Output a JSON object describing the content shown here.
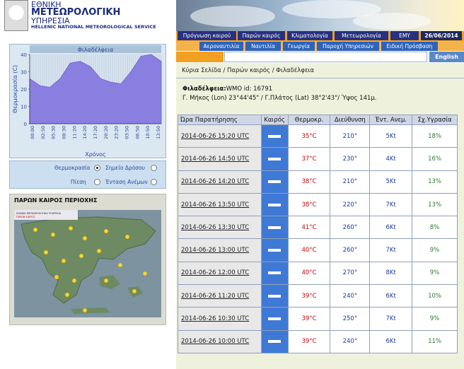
{
  "header": {
    "org_line1": "ΕΘΝΙΚΗ",
    "org_line2": "ΜΕΤΕΩΡΟΛΟΓΙΚΗ",
    "org_line3": "ΥΠΗΡΕΣΙΑ",
    "org_english": "HELLENIC NATIONAL METEOROLOGICAL SERVICE"
  },
  "nav": {
    "items": [
      "Πρόγνωση καιρού",
      "Παρών καιρός",
      "Κλιματολογία",
      "Μετεωρολογία",
      "ΕΜΥ"
    ],
    "date": "26/06/2014",
    "subitems": [
      "Αεροναυτιλία",
      "Ναυτιλία",
      "Γεωργία",
      "Παροχή Υπηρεσιών",
      "Ειδική Πρόσβαση"
    ],
    "english": "English"
  },
  "breadcrumb": "Κύρια Σελίδα / Παρών καιρός / Φιλαδέλφεια",
  "station": {
    "name": "Φιλαδέλφεια:",
    "wmo": "WMO id: 16791",
    "coords": "Γ. Μήκος (Lon) 23°44'45\" / Γ.Πλάτος (Lat) 38°2'43\"/ Ύψος 141μ."
  },
  "chart_data": {
    "type": "area",
    "title": "Φιλαδέλφεια",
    "ylabel": "Θερμοκρασία (C)",
    "xlabel": "Χρόνος",
    "ylim": [
      0,
      40
    ],
    "yticks": [
      0,
      5,
      10,
      15,
      20,
      25,
      30,
      35,
      40
    ],
    "x": [
      "00:00",
      "02:50",
      "05:30",
      "08:30",
      "11:20",
      "14:20",
      "17:20",
      "20:20",
      "23:20",
      "03:50",
      "06:50",
      "10:50",
      "13:50"
    ],
    "values": [
      26,
      22,
      21,
      26,
      35,
      36,
      33,
      26,
      24,
      23,
      30,
      39,
      40,
      36
    ],
    "color": "#8a7fe0"
  },
  "legend": {
    "temperature": "Θερμοκρασία",
    "dewpoint": "Σημείο Δρόσου",
    "pressure": "Πίεση",
    "wind": "Ένταση Ανέμων"
  },
  "region": {
    "header": "ΠΑΡΩΝ ΚΑΙΡΟΣ ΠΕΡΙΟΧΗΣ",
    "map_title": "ΕΘΝΙΚΗ ΜΕΤΕΩΡΟΛΟΓΙΚΗ ΥΠΗΡΕΣΙΑ",
    "map_subtitle": "ΠΑΡΩΝ ΚΑΙΡΟΣ"
  },
  "table": {
    "headers": [
      "Ώρα Παρατήρησης",
      "Καιρός",
      "Θερμοκρ.",
      "Διεύθυνση",
      "Έντ. Ανεμ.",
      "Σχ.Υγρασία"
    ],
    "rows": [
      {
        "time": "2014-06-26 15:20 UTC",
        "temp": "35°C",
        "dir": "210°",
        "wind": "5Kt",
        "hum": "18%"
      },
      {
        "time": "2014-06-26 14:50 UTC",
        "temp": "37°C",
        "dir": "230°",
        "wind": "4Kt",
        "hum": "16%"
      },
      {
        "time": "2014-06-26 14:20 UTC",
        "temp": "38°C",
        "dir": "210°",
        "wind": "5Kt",
        "hum": "13%"
      },
      {
        "time": "2014-06-26 13:50 UTC",
        "temp": "38°C",
        "dir": "220°",
        "wind": "7Kt",
        "hum": "13%"
      },
      {
        "time": "2014-06-26 13:30 UTC",
        "temp": "41°C",
        "dir": "260°",
        "wind": "6Kt",
        "hum": "8%"
      },
      {
        "time": "2014-06-26 13:00 UTC",
        "temp": "40°C",
        "dir": "260°",
        "wind": "7Kt",
        "hum": "9%"
      },
      {
        "time": "2014-06-26 12:00 UTC",
        "temp": "40°C",
        "dir": "270°",
        "wind": "8Kt",
        "hum": "9%"
      },
      {
        "time": "2014-06-26 11:20 UTC",
        "temp": "39°C",
        "dir": "240°",
        "wind": "6Kt",
        "hum": "10%"
      },
      {
        "time": "2014-06-26 10:30 UTC",
        "temp": "39°C",
        "dir": "250°",
        "wind": "7Kt",
        "hum": "9%"
      },
      {
        "time": "2014-06-26 10:00 UTC",
        "temp": "39°C",
        "dir": "240°",
        "wind": "6Kt",
        "hum": "11%"
      }
    ]
  }
}
